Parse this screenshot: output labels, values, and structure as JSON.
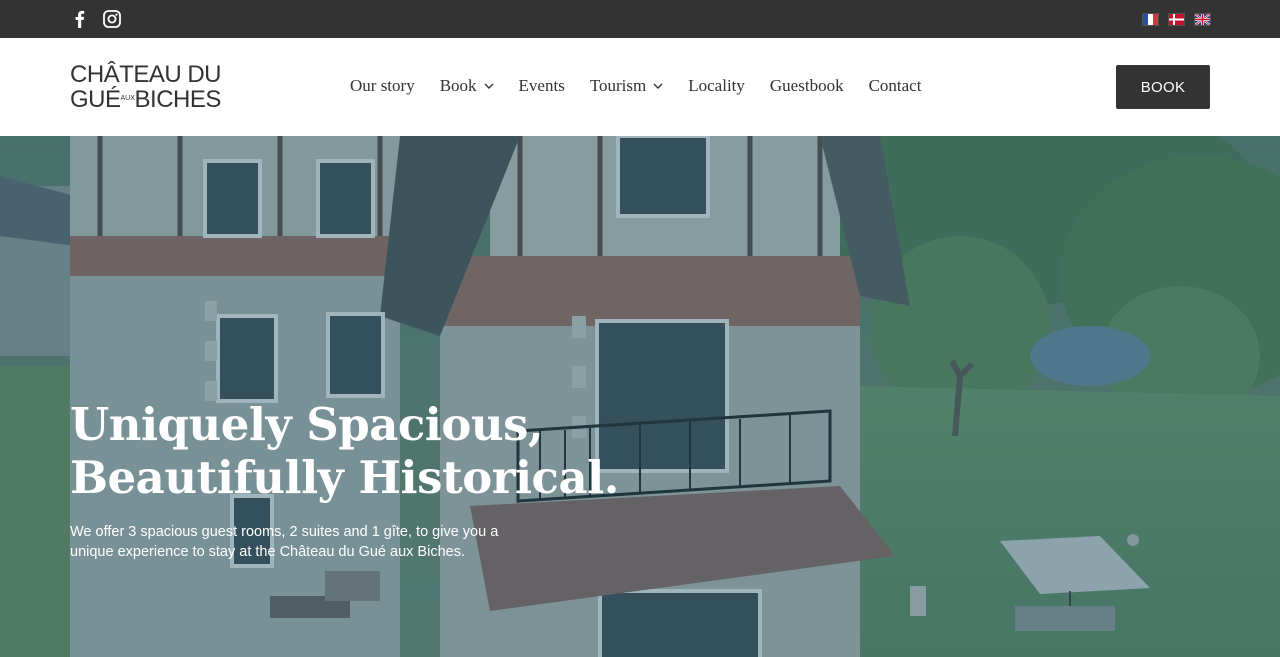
{
  "topbar": {
    "social": [
      {
        "icon": "facebook-icon"
      },
      {
        "icon": "instagram-icon"
      }
    ],
    "languages": [
      {
        "icon": "flag-france-icon"
      },
      {
        "icon": "flag-denmark-icon"
      },
      {
        "icon": "flag-uk-icon"
      }
    ]
  },
  "header": {
    "logo": {
      "line1": "CHÂTEAU DU",
      "line2_a": "GUÉ",
      "line2_small_a": "AUX",
      "line2_b": "BICHES"
    },
    "nav": [
      {
        "label": "Our story",
        "has_dropdown": false
      },
      {
        "label": "Book",
        "has_dropdown": true
      },
      {
        "label": "Events",
        "has_dropdown": false
      },
      {
        "label": "Tourism",
        "has_dropdown": true
      },
      {
        "label": "Locality",
        "has_dropdown": false
      },
      {
        "label": "Guestbook",
        "has_dropdown": false
      },
      {
        "label": "Contact",
        "has_dropdown": false
      }
    ],
    "book_button": "BOOK"
  },
  "hero": {
    "title_line1": "Uniquely Spacious,",
    "title_line2": "Beautifully Historical.",
    "text": "We offer 3 spacious guest rooms, 2 suites and 1 gîte, to give you a unique experience to stay at the Château du Gué aux Biches."
  },
  "colors": {
    "topbar": "#333333",
    "header": "#ffffff",
    "button": "#333333",
    "overlay": "#2f6f8a"
  }
}
